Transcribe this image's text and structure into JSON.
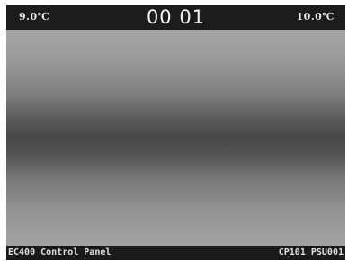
{
  "topbar": {
    "temp_left": "9.0℃",
    "clock": "00 01",
    "temp_right": "10.0℃"
  },
  "bottombar": {
    "panel_name": "EC400 Control Panel",
    "device_ids": "CP101 PSU001"
  },
  "colors": {
    "bar_background": "#1a1a1a",
    "text": "#e6e6e6"
  }
}
